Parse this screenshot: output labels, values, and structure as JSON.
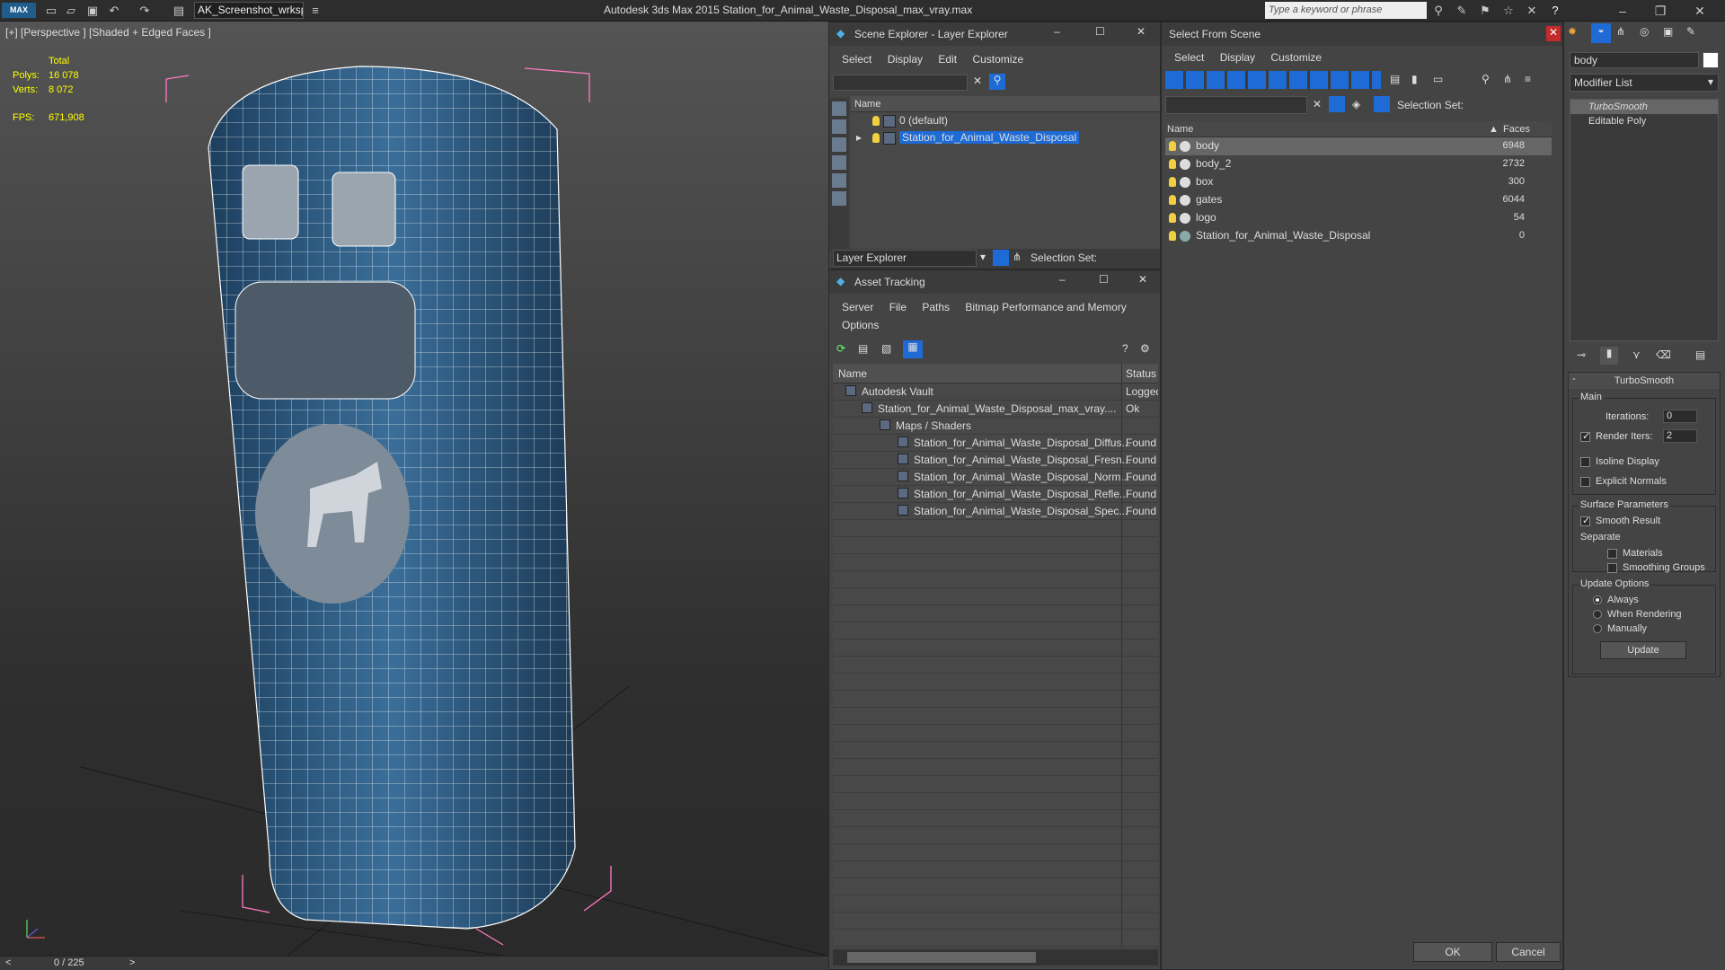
{
  "app": {
    "title": "Autodesk 3ds Max  2015    Station_for_Animal_Waste_Disposal_max_vray.max",
    "workspace": "AK_Screenshot_wrksp",
    "search_placeholder": "Type a keyword or phrase",
    "logo": "MAX"
  },
  "viewport": {
    "label": "[+] [Perspective ] [Shaded + Edged Faces ]",
    "stats": {
      "total_label": "Total",
      "polys_label": "Polys:",
      "polys": "16 078",
      "verts_label": "Verts:",
      "verts": "8 072",
      "fps_label": "FPS:",
      "fps": "671,908"
    },
    "frame": "0 / 225",
    "prev": "<",
    "next": ">"
  },
  "scene_explorer": {
    "title": "Scene Explorer - Layer Explorer",
    "menu": [
      "Select",
      "Display",
      "Edit",
      "Customize"
    ],
    "col_name": "Name",
    "layers": [
      {
        "name": "0 (default)"
      },
      {
        "name": "Station_for_Animal_Waste_Disposal"
      }
    ],
    "footer_label": "Layer Explorer",
    "selection_set": "Selection Set:"
  },
  "asset_tracking": {
    "title": "Asset Tracking",
    "menu": [
      "Server",
      "File",
      "Paths",
      "Bitmap Performance and Memory"
    ],
    "menu2": "Options",
    "col_name": "Name",
    "col_status": "Status",
    "rows": [
      {
        "name": "Autodesk Vault",
        "status": "Logged"
      },
      {
        "name": "Station_for_Animal_Waste_Disposal_max_vray....",
        "status": "Ok"
      },
      {
        "name": "Maps / Shaders",
        "status": ""
      },
      {
        "name": "Station_for_Animal_Waste_Disposal_Diffus...",
        "status": "Found"
      },
      {
        "name": "Station_for_Animal_Waste_Disposal_Fresn...",
        "status": "Found"
      },
      {
        "name": "Station_for_Animal_Waste_Disposal_Norm...",
        "status": "Found"
      },
      {
        "name": "Station_for_Animal_Waste_Disposal_Refle...",
        "status": "Found"
      },
      {
        "name": "Station_for_Animal_Waste_Disposal_Spec...",
        "status": "Found"
      }
    ]
  },
  "select_from_scene": {
    "title": "Select From Scene",
    "menu": [
      "Select",
      "Display",
      "Customize"
    ],
    "selection_set": "Selection Set:",
    "col_name": "Name",
    "col_faces": "Faces",
    "objects": [
      {
        "name": "body",
        "faces": "6948"
      },
      {
        "name": "body_2",
        "faces": "2732"
      },
      {
        "name": "box",
        "faces": "300"
      },
      {
        "name": "gates",
        "faces": "6044"
      },
      {
        "name": "logo",
        "faces": "54"
      },
      {
        "name": "Station_for_Animal_Waste_Disposal",
        "faces": "0"
      }
    ],
    "ok": "OK",
    "cancel": "Cancel"
  },
  "modify_panel": {
    "object_name": "body",
    "modifier_list": "Modifier List",
    "stack": [
      "TurboSmooth",
      "Editable Poly"
    ],
    "rollout_title": "TurboSmooth",
    "main": "Main",
    "iterations_label": "Iterations:",
    "iterations": "0",
    "render_iters_label": "Render Iters:",
    "render_iters": "2",
    "isoline": "Isoline Display",
    "explicit_normals": "Explicit Normals",
    "surface_params": "Surface Parameters",
    "smooth_result": "Smooth Result",
    "separate": "Separate",
    "materials": "Materials",
    "smoothing_groups": "Smoothing Groups",
    "update_options": "Update Options",
    "always": "Always",
    "when_rendering": "When Rendering",
    "manually": "Manually",
    "update": "Update"
  },
  "colors": {
    "accent": "#1e6bd6",
    "model": "#2d5b82",
    "wire": "#ffffff",
    "selection_box": "#ff7ac0"
  }
}
